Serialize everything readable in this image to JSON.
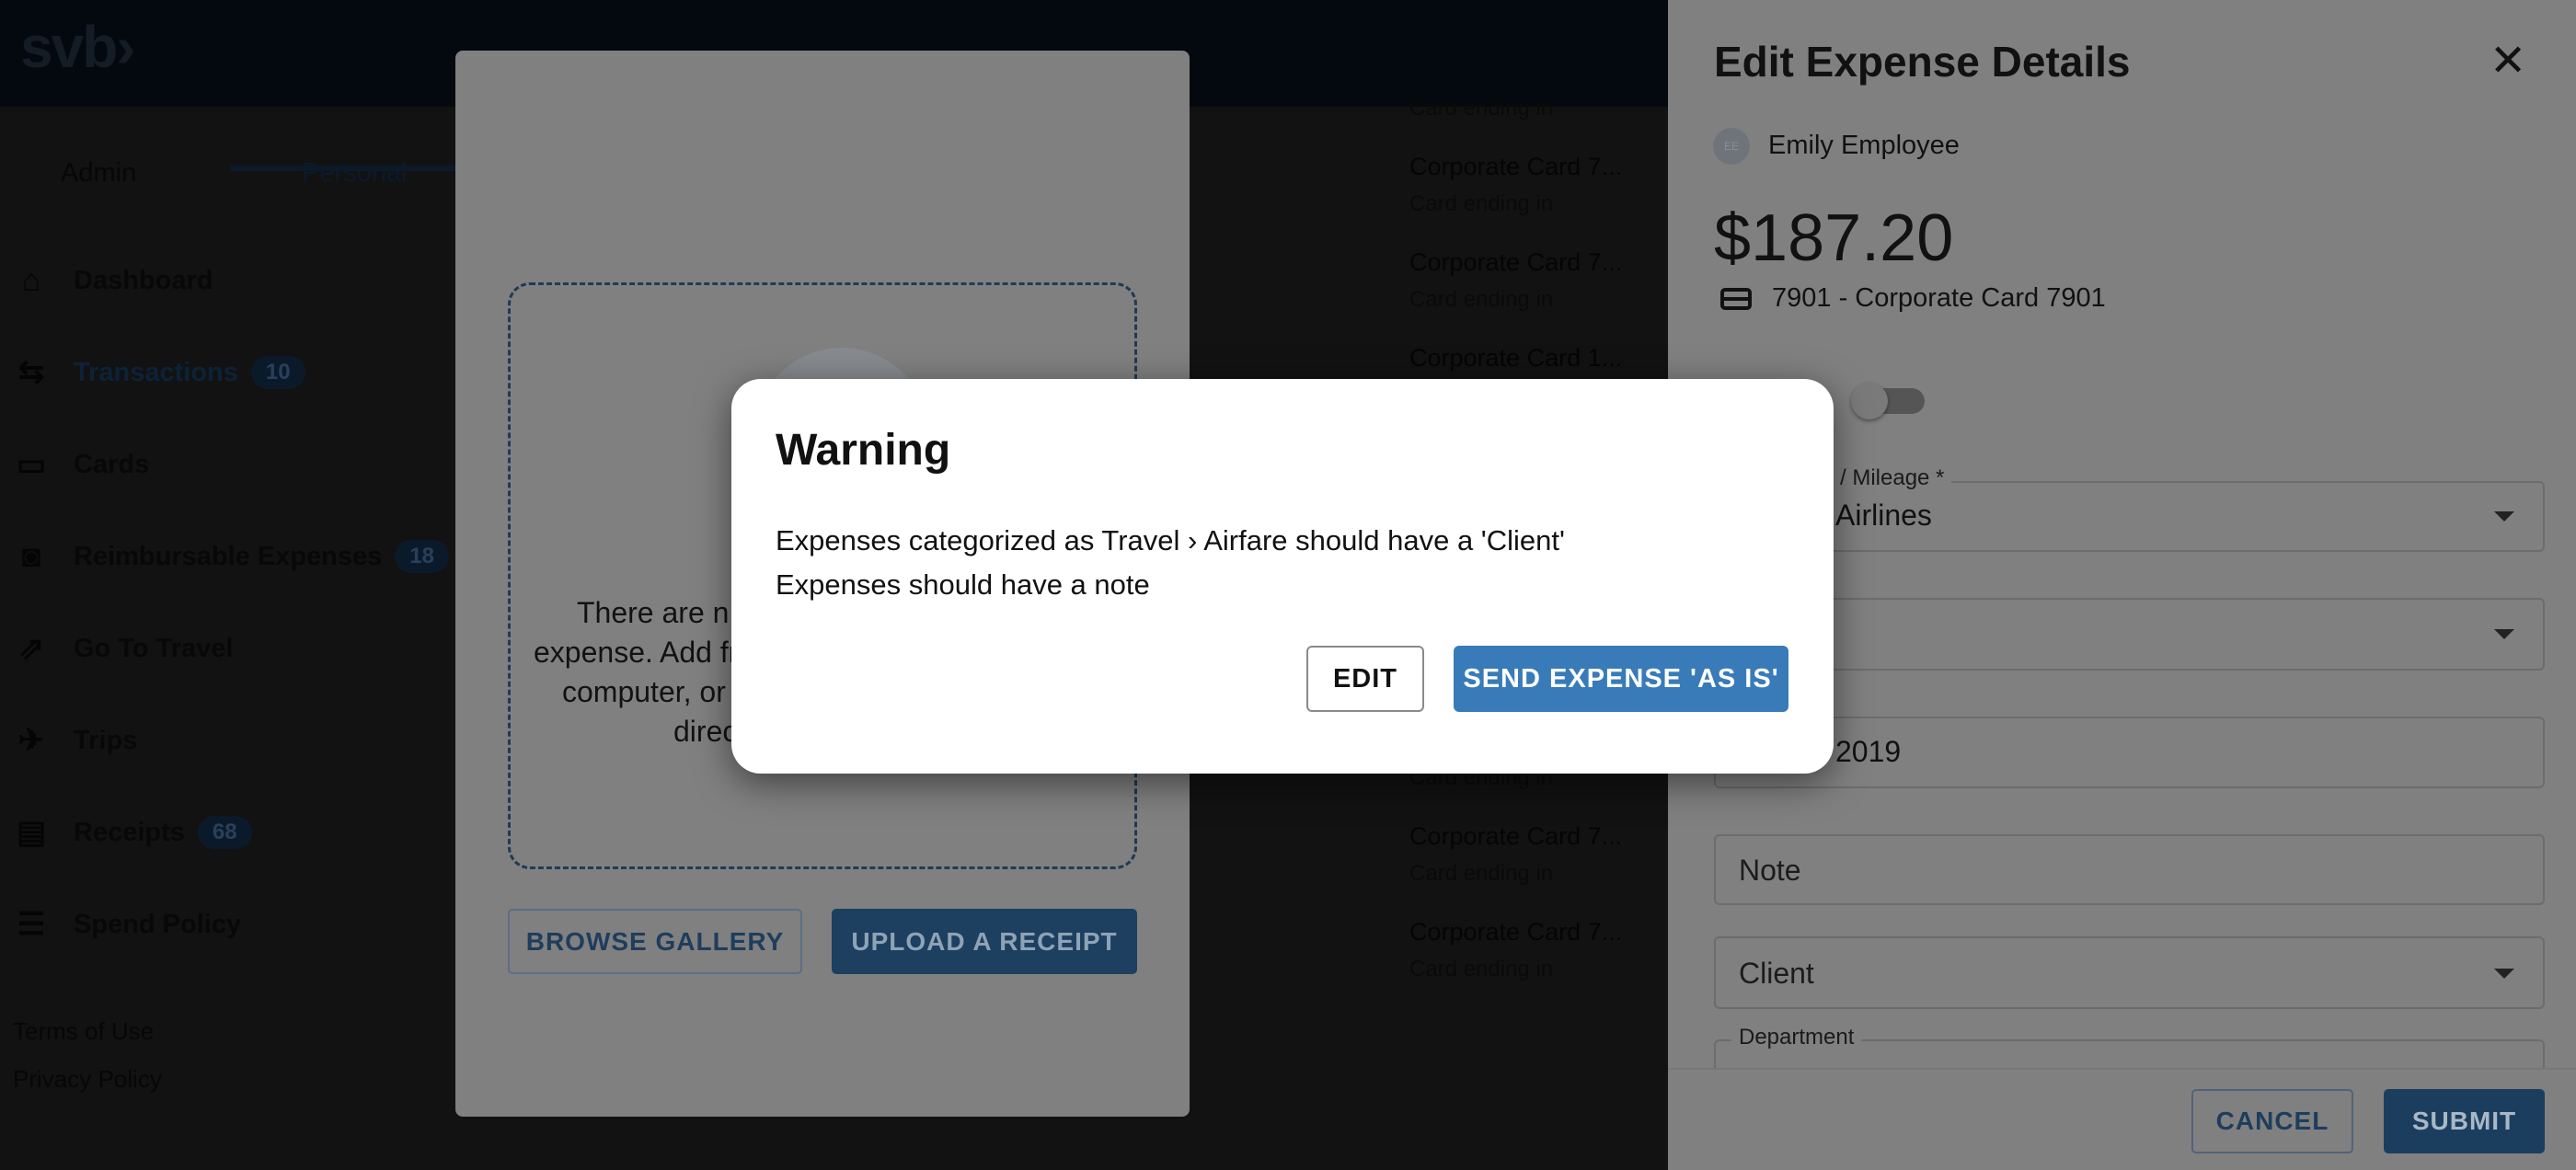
{
  "app": {
    "logo": "svb›"
  },
  "sidebar": {
    "tabs": [
      {
        "label": "Admin"
      },
      {
        "label": "Personal",
        "active": true
      }
    ],
    "items": [
      {
        "label": "Dashboard",
        "icon": "home-icon",
        "glyph": "⌂"
      },
      {
        "label": "Transactions",
        "icon": "bank-transfer-icon",
        "glyph": "⇆",
        "badge": "10"
      },
      {
        "label": "Cards",
        "icon": "card-icon",
        "glyph": "▭"
      },
      {
        "label": "Reimbursable Expenses",
        "icon": "person-cash-icon",
        "glyph": "◙",
        "badge": "18"
      },
      {
        "label": "Go To Travel",
        "icon": "external-link-icon",
        "glyph": "⇗"
      },
      {
        "label": "Trips",
        "icon": "airplane-icon",
        "glyph": "✈"
      },
      {
        "label": "Receipts",
        "icon": "receipt-icon",
        "glyph": "▤",
        "badge": "68"
      },
      {
        "label": "Spend Policy",
        "icon": "policy-icon",
        "glyph": "☰"
      }
    ],
    "footer_links": [
      "Terms of Use",
      "Privacy Policy"
    ]
  },
  "receipt_panel": {
    "empty_text_lines": [
      "There are n",
      "expense. Add fr",
      "computer, or",
      "direc"
    ],
    "browse_label": "BROWSE GALLERY",
    "upload_label": "UPLOAD A RECEIPT"
  },
  "card_list": [
    {
      "title": "",
      "subtitle": "Card ending in"
    },
    {
      "title": "Corporate Card 7...",
      "subtitle": "Card ending in"
    },
    {
      "title": "Corporate Card 7...",
      "subtitle": "Card ending in"
    },
    {
      "title": "Corporate Card 1...",
      "subtitle": ""
    },
    {
      "title": "",
      "subtitle": ""
    },
    {
      "title": "",
      "subtitle": ""
    },
    {
      "title": "",
      "subtitle": ""
    },
    {
      "title": "",
      "subtitle": "Card ending in"
    },
    {
      "title": "Corporate Card 7...",
      "subtitle": "Card ending in"
    },
    {
      "title": "Corporate Card 7...",
      "subtitle": "Card ending in"
    }
  ],
  "drawer": {
    "title": "Edit Expense Details",
    "employee_initials": "EE",
    "employee_name": "Emily Employee",
    "amount": "$187.20",
    "card": "7901 - Corporate Card 7901",
    "toggle_on": false,
    "fields": {
      "merchant": {
        "label": "/ Mileage *",
        "value": "Airlines"
      },
      "category": {
        "value": ""
      },
      "date": {
        "value": "2019"
      },
      "note": {
        "placeholder": "Note"
      },
      "client": {
        "placeholder": "Client"
      },
      "department": {
        "label": "Department"
      }
    },
    "cancel_label": "CANCEL",
    "submit_label": "SUBMIT"
  },
  "modal": {
    "title": "Warning",
    "messages": [
      "Expenses categorized as Travel › Airfare should have a 'Client'",
      "Expenses should have a note"
    ],
    "edit_label": "EDIT",
    "send_label": "SEND EXPENSE 'AS IS'"
  },
  "colors": {
    "primary": "#387bb8",
    "navy": "#1c3e5e",
    "overlay": "#121212"
  }
}
